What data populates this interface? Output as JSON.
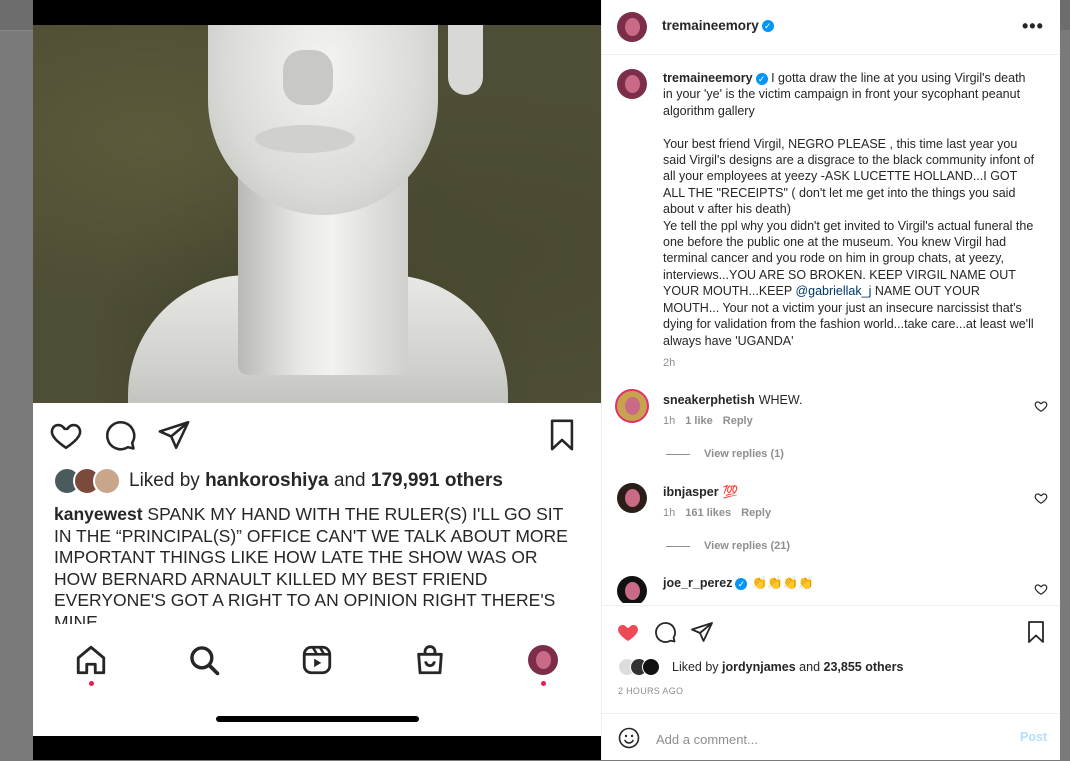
{
  "media": {
    "liked_by_prefix": "Liked by",
    "liked_by_user": "hankoroshiya",
    "liked_by_and": "and",
    "liked_by_others": "179,991 others",
    "caption_user": "kanyewest",
    "caption_text": "SPANK MY HAND WITH THE RULER(S)  I'LL GO SIT IN THE “PRINCIPAL(S)” OFFICE  CAN'T WE TALK ABOUT MORE IMPORTANT THINGS LIKE HOW LATE THE SHOW WAS OR HOW BERNARD ARNAULT  KILLED MY BEST FRIEND  EVERYONE'S GOT A RIGHT TO AN OPINION RIGHT THERE'S MINE"
  },
  "post": {
    "username": "tremaineemory",
    "more_label": "•••",
    "caption_user": "tremaineemory",
    "caption_p1": "I gotta draw the line at you using Virgil's death in your 'ye' is the victim campaign in front your sycophant peanut algorithm gallery\n\nYour best friend Virgil, NEGRO PLEASE , this time last year you said Virgil's designs are a disgrace to the black community infont of all your employees at yeezy -ASK LUCETTE HOLLAND...I GOT ALL THE \"RECEIPTS\" ( don't let me get into the things you said about v after his death)\nYe tell the ppl why you didn't get invited to Virgil's actual funeral the one before the public one at the museum. You knew Virgil had terminal cancer and you rode on him in group chats, at yeezy, interviews...YOU ARE SO BROKEN. KEEP VIRGIL NAME OUT YOUR MOUTH...KEEP ",
    "caption_mention": "@gabriellak_j",
    "caption_p2": " NAME OUT YOUR MOUTH... Your not a victim your just an insecure narcissist that's dying for validation from the fashion world...take care...at least we'll always have 'UGANDA'",
    "time": "2h"
  },
  "comments": [
    {
      "user": "sneakerphetish",
      "text": "WHEW.",
      "time": "1h",
      "likes": "1 like",
      "reply": "Reply",
      "view_replies": "View replies (1)"
    },
    {
      "user": "ibnjasper",
      "text": "💯",
      "time": "1h",
      "likes": "161 likes",
      "reply": "Reply",
      "view_replies": "View replies (21)"
    },
    {
      "user": "joe_r_perez",
      "text": "👏👏👏👏"
    }
  ],
  "footer": {
    "liked_by_prefix": "Liked by",
    "liked_by_user": "jordynjames",
    "liked_by_and": "and",
    "liked_by_others": "23,855 others",
    "date": "2 HOURS AGO",
    "comment_placeholder": "Add a comment...",
    "post_label": "Post"
  },
  "colors": {
    "like_red": "#ed4956",
    "verified_blue": "#0095f6",
    "post_button_disabled": "#b2dffc"
  }
}
